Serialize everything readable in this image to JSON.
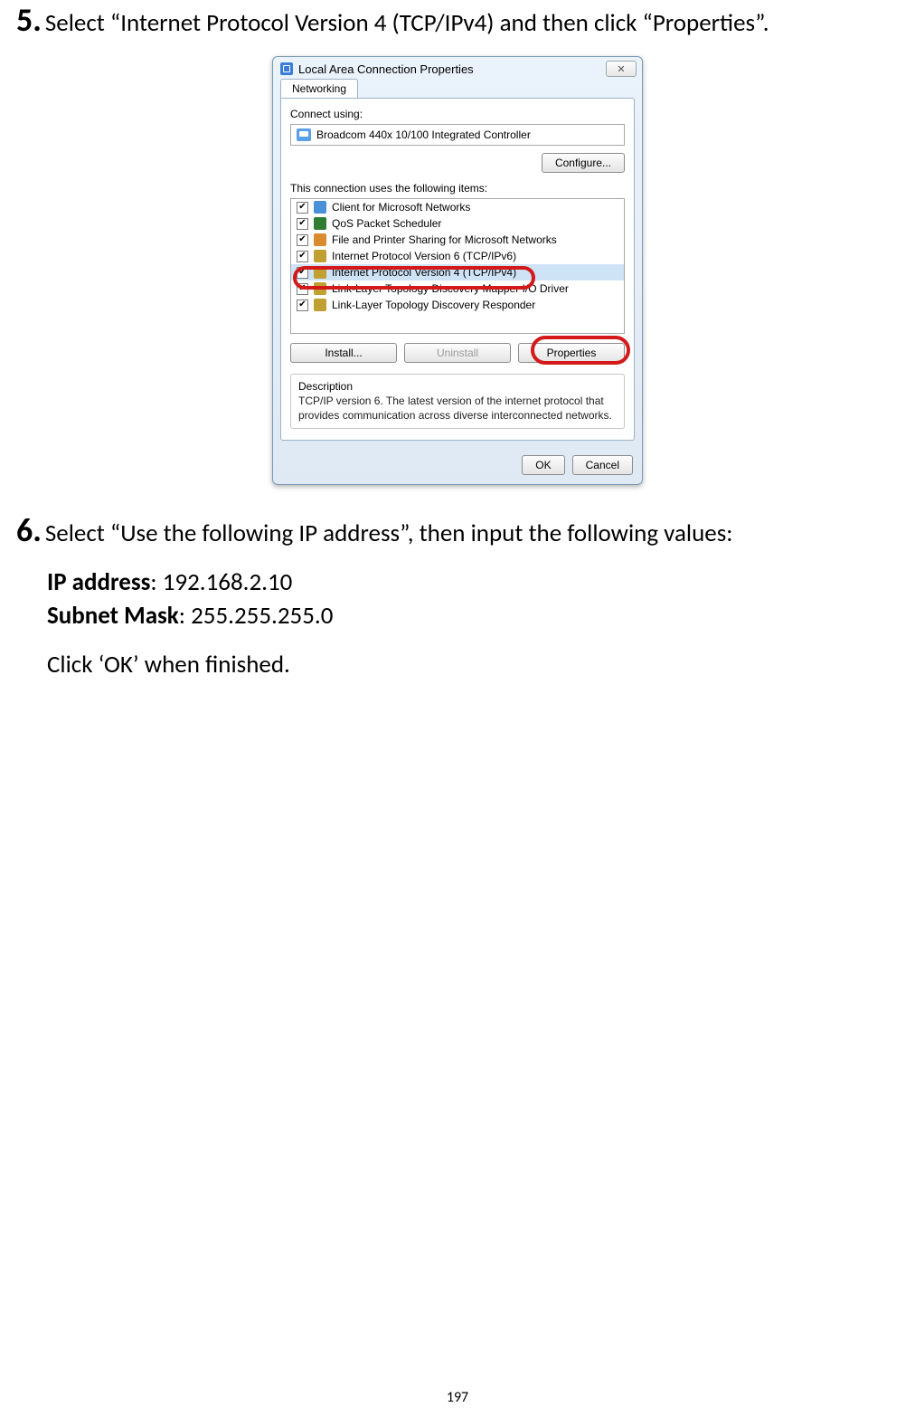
{
  "step5": {
    "num": "5.",
    "text": "Select “Internet Protocol Version 4 (TCP/IPv4) and then click “Properties”."
  },
  "dialog": {
    "title": "Local Area Connection Properties",
    "close": "✕",
    "tab": "Networking",
    "connect_using_label": "Connect using:",
    "adapter": "Broadcom 440x 10/100 Integrated Controller",
    "configure_btn": "Configure...",
    "items_label": "This connection uses the following items:",
    "items": [
      {
        "label": "Client for Microsoft Networks"
      },
      {
        "label": "QoS Packet Scheduler"
      },
      {
        "label": "File and Printer Sharing for Microsoft Networks"
      },
      {
        "label": "Internet Protocol Version 6 (TCP/IPv6)"
      },
      {
        "label": "Internet Protocol Version 4 (TCP/IPv4)"
      },
      {
        "label": "Link-Layer Topology Discovery Mapper I/O Driver"
      },
      {
        "label": "Link-Layer Topology Discovery Responder"
      }
    ],
    "install_btn": "Install...",
    "uninstall_btn": "Uninstall",
    "properties_btn": "Properties",
    "desc_title": "Description",
    "desc_body": "TCP/IP version 6. The latest version of the internet protocol that provides communication across diverse interconnected networks.",
    "ok_btn": "OK",
    "cancel_btn": "Cancel"
  },
  "step6": {
    "num": "6.",
    "text": "Select “Use the following IP address”, then input the following values:"
  },
  "details": {
    "ip_label": "IP address",
    "ip_value": ": 192.168.2.10",
    "mask_label": "Subnet Mask",
    "mask_value": ": 255.255.255.0",
    "finish": "Click ‘OK’ when finished."
  },
  "page_number": "197"
}
